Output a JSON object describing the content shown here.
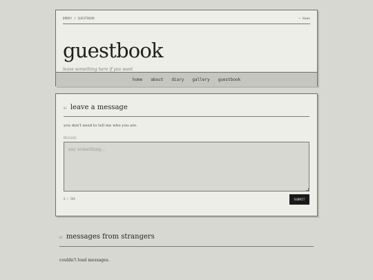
{
  "breadcrumb": "DMBOY / GUESTBOOK",
  "home_link": "← Home",
  "site": {
    "title": "guestbook",
    "tagline": "leave something here if you want"
  },
  "nav": {
    "items": [
      "home",
      "about",
      "diary",
      "gallery",
      "guestbook"
    ]
  },
  "form": {
    "section_number": "01",
    "title": "leave a message",
    "intro": "you don't need to tell me who you are.",
    "field_label": "MESSAGE",
    "placeholder": "say something...",
    "char_count": "0 / 500",
    "submit_label": "SUBMIT"
  },
  "messages": {
    "section_number": "02",
    "title": "messages from strangers",
    "status": "couldn't load messages."
  }
}
